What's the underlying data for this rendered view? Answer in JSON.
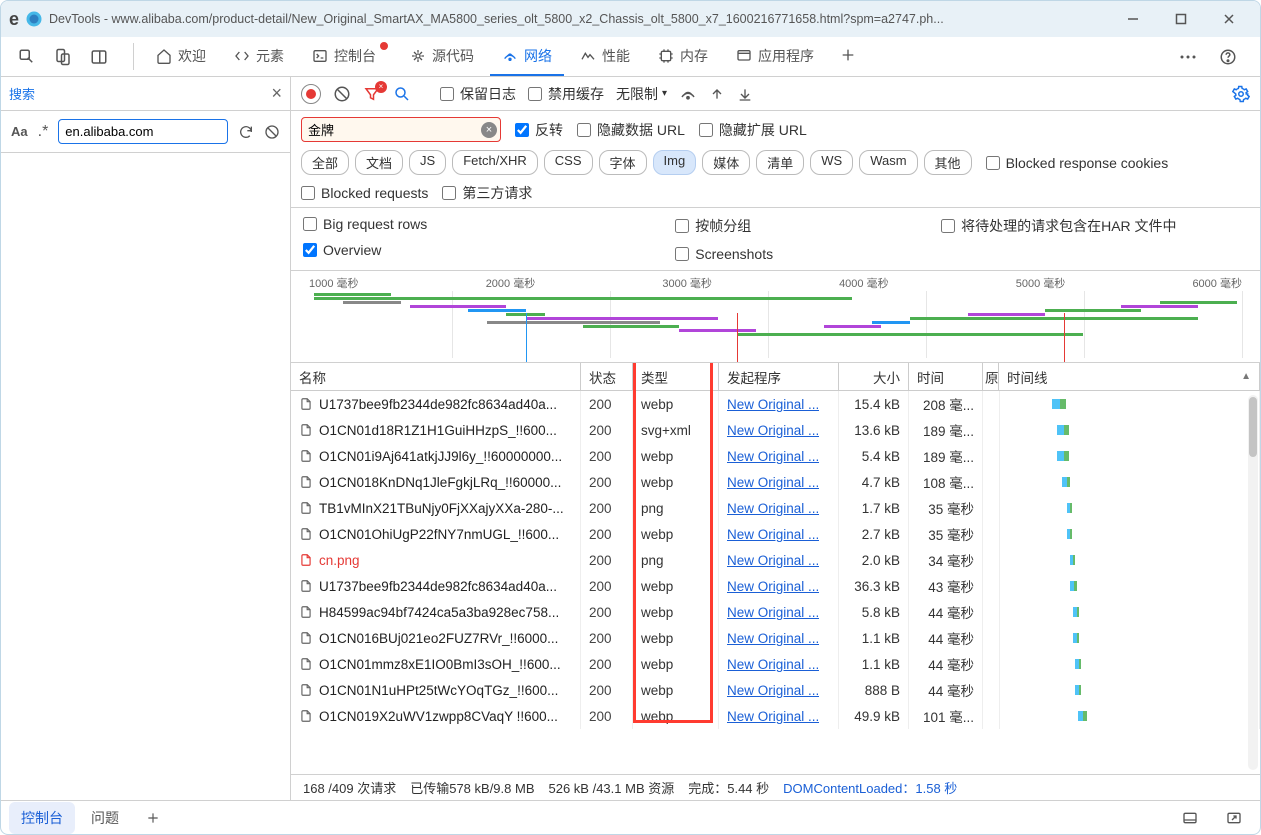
{
  "window": {
    "title": "DevTools - www.alibaba.com/product-detail/New_Original_SmartAX_MA5800_series_olt_5800_x2_Chassis_olt_5800_x7_1600216771658.html?spm=a2747.ph..."
  },
  "tabs": {
    "welcome": "欢迎",
    "elements": "元素",
    "console": "控制台",
    "sources": "源代码",
    "network": "网络",
    "performance": "性能",
    "memory": "内存",
    "application": "应用程序"
  },
  "searchPane": {
    "label": "搜索",
    "urlFilter": "en.alibaba.com"
  },
  "toolbar": {
    "preserveLog": "保留日志",
    "disableCache": "禁用缓存",
    "throttle": "无限制"
  },
  "filterRow": {
    "filterValue": "金牌",
    "invert": "反转",
    "hideDataUrl": "隐藏数据 URL",
    "hideExtUrl": "隐藏扩展 URL"
  },
  "typePills": {
    "all": "全部",
    "doc": "文档",
    "js": "JS",
    "fetch": "Fetch/XHR",
    "css": "CSS",
    "font": "字体",
    "img": "Img",
    "media": "媒体",
    "manifest": "清单",
    "ws": "WS",
    "wasm": "Wasm",
    "other": "其他",
    "blockedCookies": "Blocked response cookies"
  },
  "extraFilters": {
    "blockedRequests": "Blocked requests",
    "thirdParty": "第三方请求"
  },
  "opts": {
    "bigRows": "Big request rows",
    "overview": "Overview",
    "groupByFrame": "按帧分组",
    "screenshots": "Screenshots",
    "harPending": "将待处理的请求包含在HAR 文件中"
  },
  "ticks": [
    "1000 毫秒",
    "2000 毫秒",
    "3000 毫秒",
    "4000 毫秒",
    "5000 毫秒",
    "6000 毫秒"
  ],
  "columns": {
    "name": "名称",
    "status": "状态",
    "type": "类型",
    "initiator": "发起程序",
    "size": "大小",
    "time": "时间",
    "todo": "原",
    "waterfall": "时间线"
  },
  "rows": [
    {
      "name": "U1737bee9fb2344de982fc8634ad40a...",
      "status": "200",
      "type": "webp",
      "init": "New Original ...",
      "size": "15.4 kB",
      "time": "208 毫...",
      "wf": [
        20,
        8,
        6
      ]
    },
    {
      "name": "O1CN01d18R1Z1H1GuiHHzpS_!!600...",
      "status": "200",
      "type": "svg+xml",
      "init": "New Original ...",
      "size": "13.6 kB",
      "time": "189 毫...",
      "wf": [
        22,
        7,
        5
      ]
    },
    {
      "name": "O1CN01i9Aj641atkjJJ9l6y_!!60000000...",
      "status": "200",
      "type": "webp",
      "init": "New Original ...",
      "size": "5.4 kB",
      "time": "189 毫...",
      "wf": [
        22,
        7,
        5
      ]
    },
    {
      "name": "O1CN018KnDNq1JleFgkjLRq_!!60000...",
      "status": "200",
      "type": "webp",
      "init": "New Original ...",
      "size": "4.7 kB",
      "time": "108 毫...",
      "wf": [
        24,
        5,
        3
      ]
    },
    {
      "name": "TB1vMInX21TBuNjy0FjXXajyXXa-280-...",
      "status": "200",
      "type": "png",
      "init": "New Original ...",
      "size": "1.7 kB",
      "time": "35 毫秒",
      "wf": [
        26,
        3,
        2
      ]
    },
    {
      "name": "O1CN01OhiUgP22fNY7nmUGL_!!600...",
      "status": "200",
      "type": "webp",
      "init": "New Original ...",
      "size": "2.7 kB",
      "time": "35 毫秒",
      "wf": [
        26,
        3,
        2
      ]
    },
    {
      "name": "cn.png",
      "status": "200",
      "type": "png",
      "init": "New Original ...",
      "size": "2.0 kB",
      "time": "34 毫秒",
      "red": true,
      "wf": [
        27,
        3,
        2
      ]
    },
    {
      "name": "U1737bee9fb2344de982fc8634ad40a...",
      "status": "200",
      "type": "webp",
      "init": "New Original ...",
      "size": "36.3 kB",
      "time": "43 毫秒",
      "wf": [
        27,
        4,
        3
      ]
    },
    {
      "name": "H84599ac94bf7424ca5a3ba928ec758...",
      "status": "200",
      "type": "webp",
      "init": "New Original ...",
      "size": "5.8 kB",
      "time": "44 毫秒",
      "wf": [
        28,
        4,
        2
      ]
    },
    {
      "name": "O1CN016BUj021eo2FUZ7RVr_!!6000...",
      "status": "200",
      "type": "webp",
      "init": "New Original ...",
      "size": "1.1 kB",
      "time": "44 毫秒",
      "wf": [
        28,
        4,
        2
      ]
    },
    {
      "name": "O1CN01mmz8xE1IO0BmI3sOH_!!600...",
      "status": "200",
      "type": "webp",
      "init": "New Original ...",
      "size": "1.1 kB",
      "time": "44 毫秒",
      "wf": [
        29,
        4,
        2
      ]
    },
    {
      "name": "O1CN01N1uHPt25tWcYOqTGz_!!600...",
      "status": "200",
      "type": "webp",
      "init": "New Original ...",
      "size": "888 B",
      "time": "44 毫秒",
      "wf": [
        29,
        4,
        2
      ]
    },
    {
      "name": "O1CN019X2uWV1zwpp8CVaqY !!600...",
      "status": "200",
      "type": "webp",
      "init": "New Original ...",
      "size": "49.9 kB",
      "time": "101 毫...",
      "wf": [
        30,
        5,
        4
      ]
    }
  ],
  "statusBar": {
    "requests": "168 /409 次请求",
    "transfer": "已传输578 kB/9.8 MB",
    "resources": "526 kB /43.1 MB 资源",
    "finish": "完成：5.44 秒",
    "dom": "DOMContentLoaded：1.58 秒"
  },
  "bottom": {
    "console": "控制台",
    "issues": "问题"
  }
}
